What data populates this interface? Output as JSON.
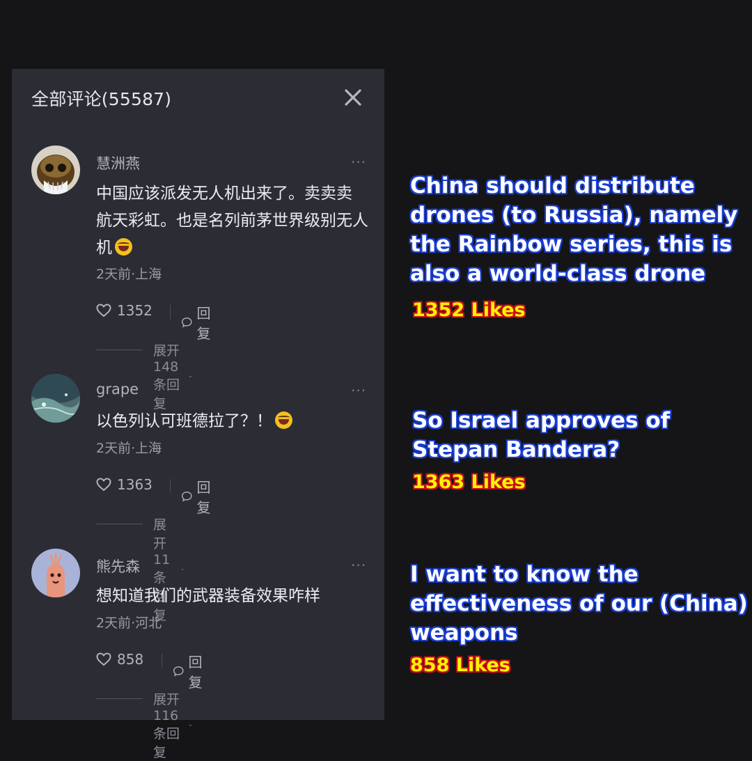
{
  "panel": {
    "title": "全部评论(55587)",
    "close_icon": "close-icon"
  },
  "comments": [
    {
      "username": "慧洲燕",
      "more": "···",
      "text": "中国应该派发无人机出来了。卖卖卖 航天彩虹。也是名列前茅世界级别无人机",
      "emoji": "rolling-on-floor-laughing-emoji",
      "meta": "2天前·上海",
      "likes": "1352",
      "reply_label": "回复",
      "expand_label": "展开148条回复"
    },
    {
      "username": "grape",
      "more": "···",
      "text": "以色列认可班德拉了？！",
      "emoji": "rolling-on-floor-laughing-emoji",
      "meta": "2天前·上海",
      "likes": "1363",
      "reply_label": "回复",
      "expand_label": "展开11条回复"
    },
    {
      "username": "熊先森",
      "more": "···",
      "text": "想知道我们的武器装备效果咋样",
      "meta": "2天前·河北",
      "likes": "858",
      "reply_label": "回复",
      "expand_label": "展开116条回复"
    }
  ],
  "captions": [
    {
      "text": "China should distribute drones (to Russia), namely the Rainbow series, this is also a world-class drone",
      "likes": "1352 Likes"
    },
    {
      "text": "So Israel approves of Stepan Bandera?",
      "likes": "1363 Likes"
    },
    {
      "text": "I want to know the effectiveness of our (China) weapons",
      "likes": "858 Likes"
    }
  ],
  "colors": {
    "background": "#151518",
    "panel": "#2c2c35",
    "caption_text": "#ffffff",
    "caption_outline": "#1a3fd0",
    "likes_text": "#fff200",
    "likes_outline": "#c4101a"
  }
}
